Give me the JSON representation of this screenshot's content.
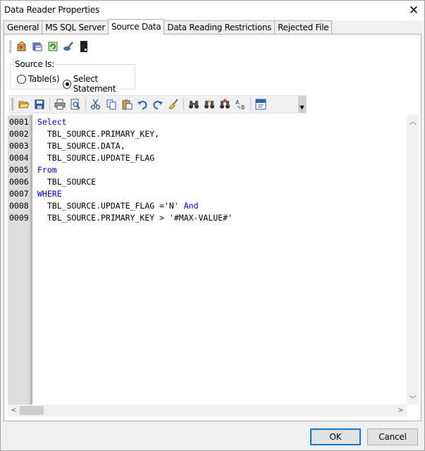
{
  "window": {
    "title": "Data Reader Properties"
  },
  "tabs": [
    {
      "label": "General",
      "active": false
    },
    {
      "label": "MS SQL Server",
      "active": false
    },
    {
      "label": "Source Data",
      "active": true
    },
    {
      "label": "Data Reading Restrictions",
      "active": false
    },
    {
      "label": "Rejected File",
      "active": false
    }
  ],
  "source": {
    "legend": "Source Is:",
    "options": [
      {
        "label": "Table(s)",
        "checked": false
      },
      {
        "label": "Select Statement",
        "checked": true
      }
    ]
  },
  "editor": {
    "lines": [
      {
        "num": "0001",
        "segments": [
          {
            "text": "Select",
            "kw": true
          }
        ]
      },
      {
        "num": "0002",
        "segments": [
          {
            "text": "  TBL_SOURCE.PRIMARY_KEY,",
            "kw": false
          }
        ]
      },
      {
        "num": "0003",
        "segments": [
          {
            "text": "  TBL_SOURCE.DATA,",
            "kw": false
          }
        ]
      },
      {
        "num": "0004",
        "segments": [
          {
            "text": "  TBL_SOURCE.UPDATE_FLAG",
            "kw": false
          }
        ]
      },
      {
        "num": "0005",
        "segments": [
          {
            "text": "From",
            "kw": true
          }
        ]
      },
      {
        "num": "0006",
        "segments": [
          {
            "text": "  TBL_SOURCE",
            "kw": false
          }
        ]
      },
      {
        "num": "0007",
        "segments": [
          {
            "text": "WHERE",
            "kw": true
          }
        ]
      },
      {
        "num": "0008",
        "segments": [
          {
            "text": "  TBL_SOURCE.UPDATE_FLAG ='N' ",
            "kw": false
          },
          {
            "text": "And",
            "kw": true
          }
        ]
      },
      {
        "num": "0009",
        "segments": [
          {
            "text": "  TBL_SOURCE.PRIMARY_KEY > '#MAX-VALUE#'",
            "kw": false
          }
        ]
      }
    ]
  },
  "buttons": {
    "ok": "OK",
    "cancel": "Cancel"
  },
  "colors": {
    "keyword": "#0000cc",
    "accent": "#0078d7"
  }
}
